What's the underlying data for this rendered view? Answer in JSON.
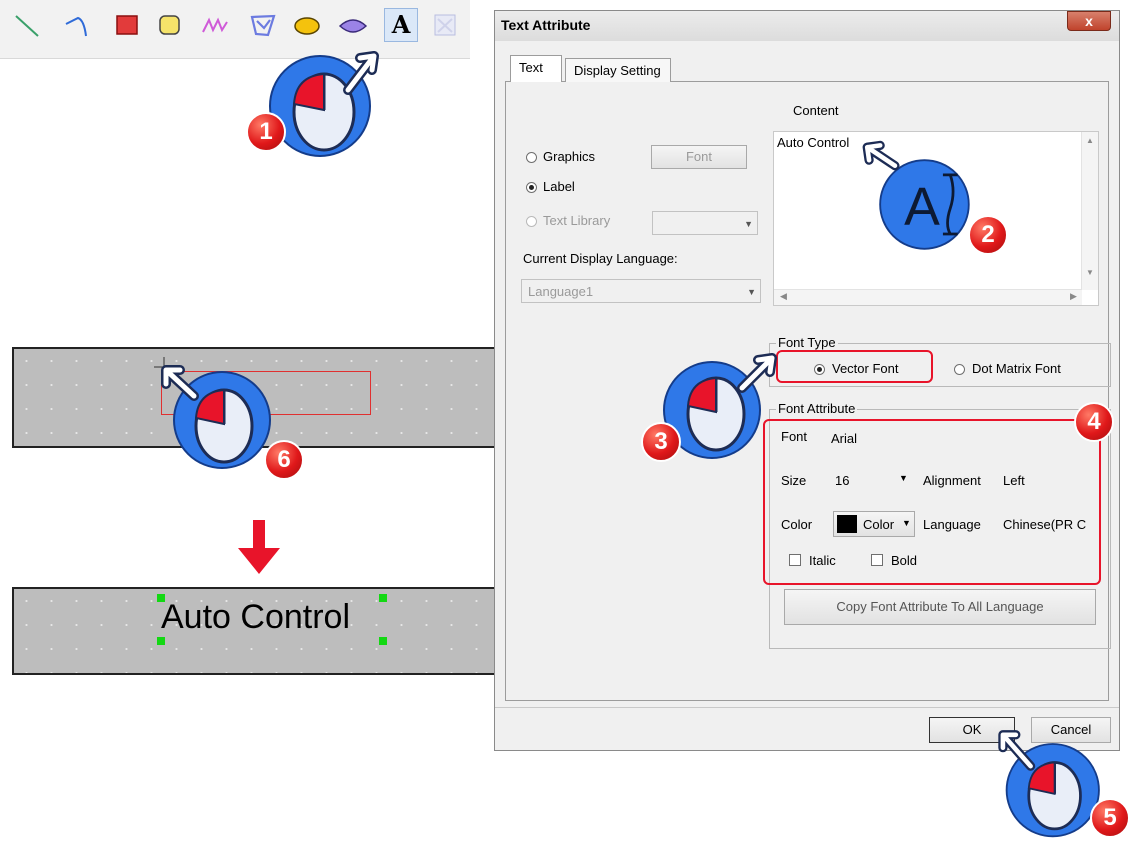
{
  "toolbar": {
    "tools": [
      {
        "name": "line-tool",
        "icon": "line-icon"
      },
      {
        "name": "polyline-tool",
        "icon": "arc-icon"
      },
      {
        "name": "rectangle-tool",
        "icon": "rectangle-icon",
        "color": "#e23b3b"
      },
      {
        "name": "rounded-rect-tool",
        "icon": "rounded-rectangle-icon",
        "color": "#f5e36a"
      },
      {
        "name": "freehand-tool",
        "icon": "wave-icon",
        "color": "#cf5ad8"
      },
      {
        "name": "polygon-tool",
        "icon": "polygon-icon",
        "color": "#6c7be0"
      },
      {
        "name": "ellipse-tool",
        "icon": "ellipse-icon",
        "color": "#f4c20d"
      },
      {
        "name": "diamond-tool",
        "icon": "diamond-icon",
        "color": "#9b83e6"
      }
    ],
    "text_tool_label": "A"
  },
  "canvas": {
    "result_text": "Auto Control"
  },
  "dialog": {
    "title": "Text Attribute",
    "close_label": "x",
    "tabs": [
      "Text",
      "Display Setting"
    ],
    "content_label": "Content",
    "content_value": "Auto Control",
    "source_options": {
      "graphics": "Graphics",
      "label": "Label",
      "text_library": "Text Library",
      "selected": "Label"
    },
    "font_button": "Font",
    "current_display_language_label": "Current Display Language:",
    "current_display_language_value": "Language1",
    "font_type": {
      "title": "Font Type",
      "vector": "Vector Font",
      "dot_matrix": "Dot Matrix Font",
      "selected": "Vector Font"
    },
    "font_attribute": {
      "title": "Font Attribute",
      "font_label": "Font",
      "font_value": "Arial",
      "size_label": "Size",
      "size_value": "16",
      "alignment_label": "Alignment",
      "alignment_value": "Left",
      "color_label": "Color",
      "color_button": "Color",
      "color_value": "#000000",
      "language_label": "Language",
      "language_value": "Chinese(PR C",
      "italic_label": "Italic",
      "bold_label": "Bold"
    },
    "copy_button": "Copy Font Attribute To All Language",
    "ok_button": "OK",
    "cancel_button": "Cancel"
  },
  "callouts": {
    "steps": [
      "1",
      "2",
      "3",
      "4",
      "5",
      "6"
    ],
    "text_cursor_glyph": "A",
    "highlight_color": "#e8142a",
    "marker_color": "#2f78e8"
  }
}
